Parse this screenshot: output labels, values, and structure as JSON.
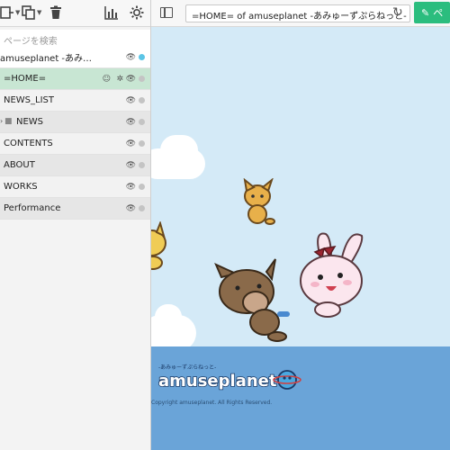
{
  "sidebar": {
    "search_placeholder": "ページを検索",
    "pages": [
      {
        "label": "amuseplanet -あみゅーずぷら…",
        "type": "root",
        "dot": "blue"
      },
      {
        "label": "=HOME=",
        "type": "selected"
      },
      {
        "label": "NEWS_LIST",
        "type": "normal"
      },
      {
        "label": "NEWS",
        "type": "folder"
      },
      {
        "label": "CONTENTS",
        "type": "normal"
      },
      {
        "label": "ABOUT",
        "type": "normal"
      },
      {
        "label": "WORKS",
        "type": "normal"
      },
      {
        "label": "Performance",
        "type": "normal"
      }
    ]
  },
  "topbar": {
    "address": "=HOME= of amuseplanet -あみゅーずぷらねっと-",
    "edit_label": "ペ"
  },
  "preview": {
    "logo_tagline": "-あみゅーずぷらねっと-",
    "logo_text": "amuseplanet",
    "copyright": "Copyright amuseplanet. All Rights Reserved."
  },
  "colors": {
    "sky": "#d4eaf7",
    "sea": "#6aa4d8",
    "selected_row": "#c8e6d3",
    "edit_button": "#2bbd7e",
    "status_dot_blue": "#5cc5e6"
  }
}
